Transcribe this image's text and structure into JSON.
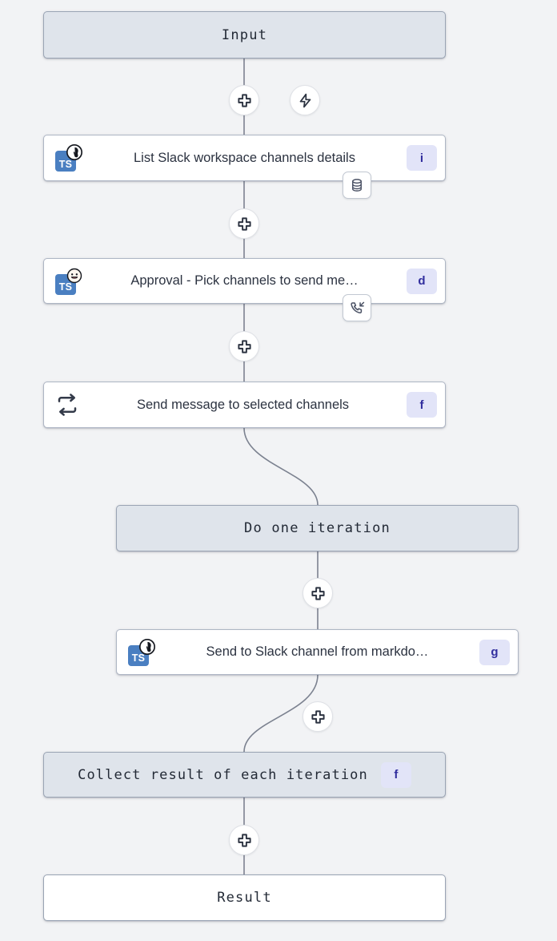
{
  "canvas": {
    "background_color": "#f2f3f5",
    "edge_color": "#7c8290"
  },
  "colors": {
    "terminal_fill": "#dfe4eb",
    "terminal_border": "#9aa4b4",
    "step_fill": "#ffffff",
    "step_border": "#aeb6c4",
    "badge_fill": "#e2e4f8",
    "badge_text": "#312e9e",
    "ts_tile_fill": "#4a7fc1",
    "text": "#2b3240"
  },
  "nodes": {
    "input": {
      "label": "Input"
    },
    "list_channels": {
      "label": "List Slack workspace channels details",
      "badge": "i",
      "icon": "typescript-deno-icon",
      "icon_tile_text": "TS",
      "kind_badge": "database-icon"
    },
    "approval": {
      "label": "Approval - Pick channels to send me…",
      "badge": "d",
      "icon": "typescript-approval-icon",
      "icon_tile_text": "TS",
      "kind_badge": "phone-incoming-icon"
    },
    "forloop": {
      "label": "Send message to selected channels",
      "badge": "f",
      "icon": "loop-repeat-icon"
    },
    "do_one_iteration": {
      "label": "Do one iteration"
    },
    "send_slack": {
      "label": "Send to Slack channel from markdo…",
      "badge": "g",
      "icon": "typescript-deno-icon",
      "icon_tile_text": "TS"
    },
    "collect": {
      "label": "Collect result of each iteration",
      "badge": "f"
    },
    "result": {
      "label": "Result"
    }
  },
  "edge_buttons": [
    {
      "name": "add-step-after-input",
      "icon": "plus-icon"
    },
    {
      "name": "add-trigger-after-input",
      "icon": "lightning-icon"
    },
    {
      "name": "add-step-after-list-channels",
      "icon": "plus-icon"
    },
    {
      "name": "add-step-after-approval",
      "icon": "plus-icon"
    },
    {
      "name": "add-step-after-do-one-iteration",
      "icon": "plus-icon"
    },
    {
      "name": "add-step-after-send-slack",
      "icon": "plus-icon"
    },
    {
      "name": "add-step-after-collect",
      "icon": "plus-icon"
    }
  ]
}
